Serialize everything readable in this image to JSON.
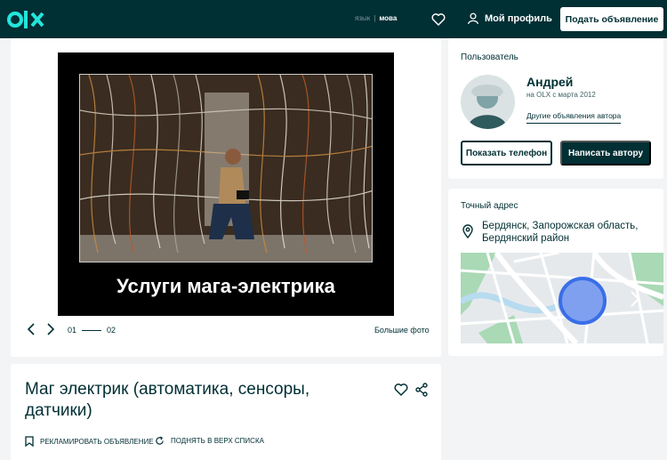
{
  "header": {
    "logo": "olx",
    "lang_ru": "язык",
    "lang_sep": "|",
    "lang_ua": "мова",
    "profile_label": "Мой профиль",
    "post_ad_label": "Подать объявление"
  },
  "gallery": {
    "caption": "Услуги мага-электрика",
    "page_current": "01",
    "page_total": "02",
    "big_photo_label": "Большие фото"
  },
  "listing": {
    "title": "Маг электрик (автоматика, сенсоры, датчики)",
    "advertise_label": "Рекламировать объявление",
    "bump_label": "Поднять в верх списка"
  },
  "user": {
    "section_label": "Пользователь",
    "name": "Андрей",
    "member_since": "на OLX с марта 2012",
    "other_ads_label": "Другие объявления автора",
    "show_phone_label": "Показать телефон",
    "write_label": "Написать автору"
  },
  "address": {
    "section_label": "Точный адрес",
    "location": "Бердянск, Запорожская область, Бердянский район"
  },
  "colors": {
    "brand_dark": "#002f34",
    "background": "#f2f4f5",
    "logo_teal": "#23e5db",
    "map_circle": "#3a77ff"
  }
}
